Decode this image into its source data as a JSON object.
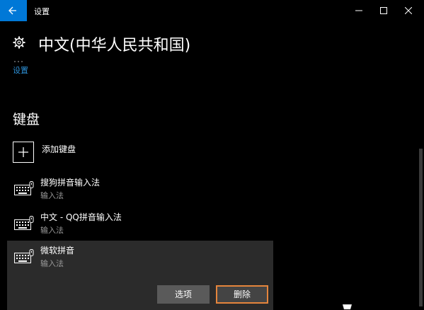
{
  "window": {
    "app_title": "设置"
  },
  "header": {
    "title": "中文(中华人民共和国)",
    "breadcrumb": "设置"
  },
  "keyboards": {
    "section_title": "键盘",
    "add_label": "添加键盘",
    "items": [
      {
        "name": "搜狗拼音输入法",
        "type": "输入法"
      },
      {
        "name": "中文 - QQ拼音输入法",
        "type": "输入法"
      },
      {
        "name": "微软拼音",
        "type": "输入法",
        "selected": true
      }
    ],
    "options_button": "选项",
    "delete_button": "删除"
  },
  "colors": {
    "accent": "#0078d7",
    "link": "#2d8fd5",
    "highlight_border": "#e5853c"
  }
}
